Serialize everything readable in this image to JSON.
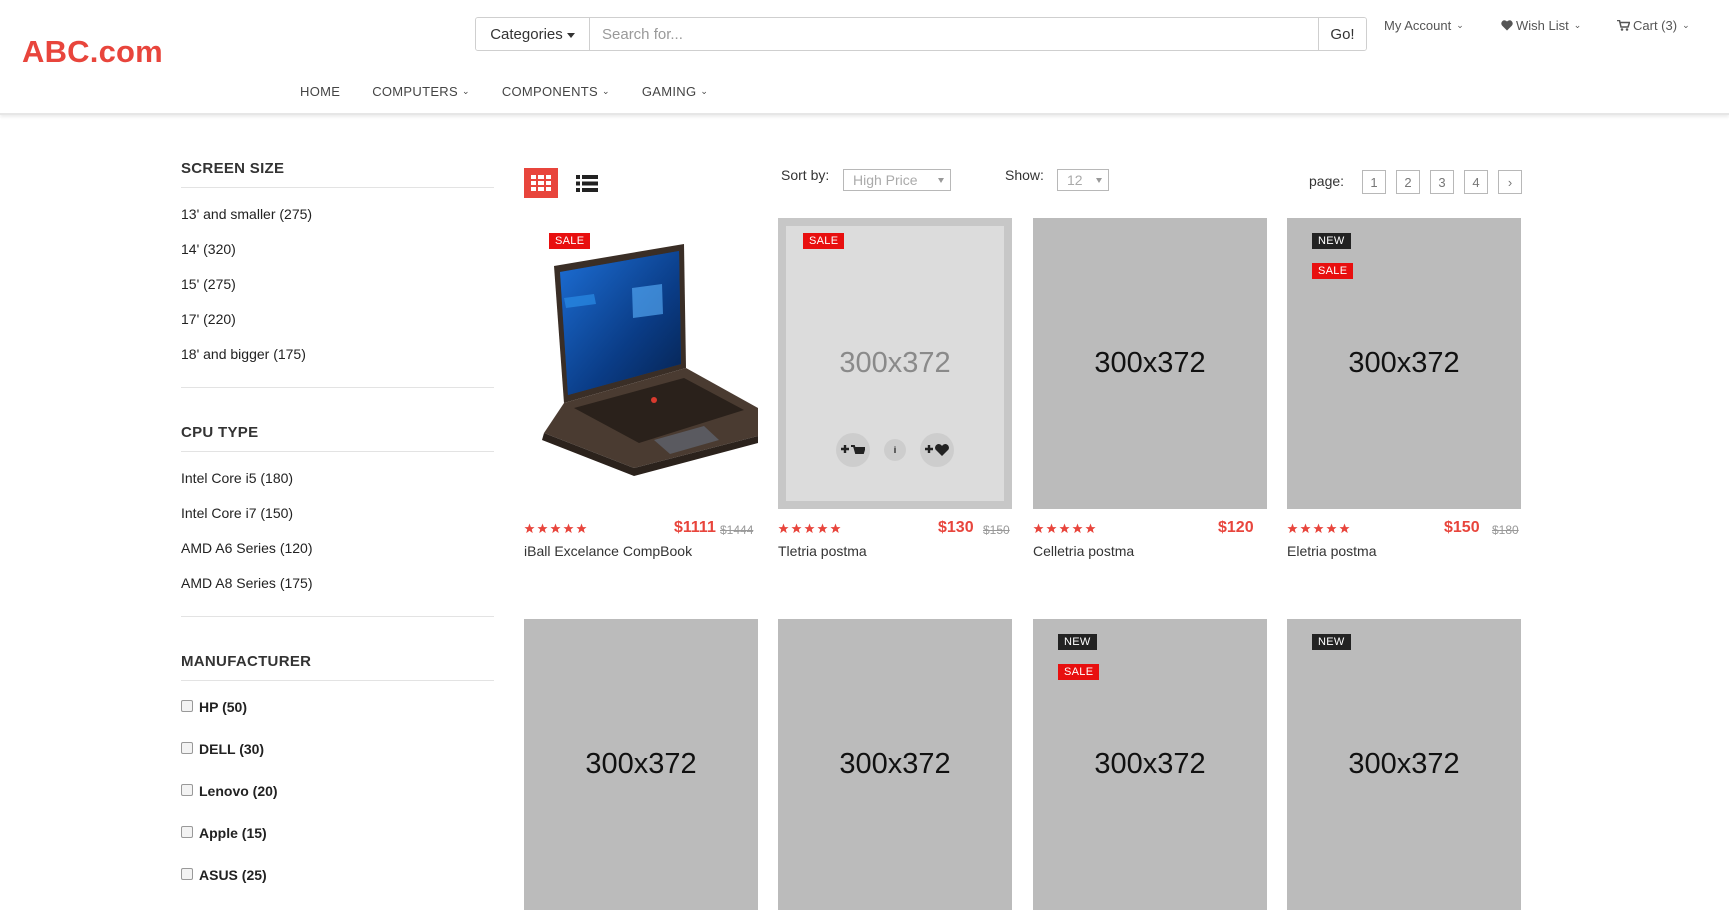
{
  "header": {
    "logo": "ABC.com",
    "search": {
      "category_label": "Categories",
      "placeholder": "Search for...",
      "go_label": "Go!"
    },
    "top_links": {
      "account": "My Account",
      "wishlist": "Wish List",
      "cart": "Cart (3)"
    },
    "nav": [
      "HOME",
      "COMPUTERS",
      "COMPONENTS",
      "GAMING"
    ]
  },
  "sidebar": {
    "screen_size": {
      "title": "SCREEN SIZE",
      "items": [
        "13' and smaller (275)",
        "14' (320)",
        "15' (275)",
        "17' (220)",
        "18' and bigger (175)"
      ]
    },
    "cpu_type": {
      "title": "CPU TYPE",
      "items": [
        "Intel Core i5 (180)",
        "Intel Core i7 (150)",
        "AMD A6 Series (120)",
        "AMD A8 Series (175)"
      ]
    },
    "manufacturer": {
      "title": "MANUFACTURER",
      "items": [
        "HP (50)",
        "DELL (30)",
        "Lenovo (20)",
        "Apple (15)",
        "ASUS (25)"
      ]
    }
  },
  "toolbar": {
    "sort_label": "Sort by:",
    "sort_value": "High Price",
    "show_label": "Show:",
    "show_value": "12",
    "page_label": "page:",
    "pages": [
      "1",
      "2",
      "3",
      "4"
    ],
    "next": "›"
  },
  "colors": {
    "accent": "#e8453c",
    "sale_badge": "#e80f0f",
    "new_badge": "#222222",
    "placeholder_bg": "#bbbbbb"
  },
  "products": [
    {
      "name": "iBall Excelance CompBook",
      "price": "$1111",
      "old_price": "$1444",
      "badges": [
        "SALE"
      ],
      "image": "laptop",
      "rating": 5
    },
    {
      "name": "Tletria postma",
      "price": "$130",
      "old_price": "$150",
      "badges": [
        "SALE"
      ],
      "placeholder": "300x372",
      "hover_actions": [
        "add-to-cart-icon",
        "info-icon",
        "add-to-wishlist-icon"
      ],
      "rating": 5
    },
    {
      "name": "Celletria postma",
      "price": "$120",
      "old_price": "",
      "badges": [],
      "placeholder": "300x372",
      "rating": 5
    },
    {
      "name": "Eletria postma",
      "price": "$150",
      "old_price": "$180",
      "badges": [
        "NEW",
        "SALE"
      ],
      "placeholder": "300x372",
      "rating": 5
    },
    {
      "badges": [],
      "placeholder": "300x372"
    },
    {
      "badges": [],
      "placeholder": "300x372"
    },
    {
      "badges": [
        "NEW",
        "SALE"
      ],
      "placeholder": "300x372"
    },
    {
      "badges": [
        "NEW"
      ],
      "placeholder": "300x372"
    }
  ]
}
